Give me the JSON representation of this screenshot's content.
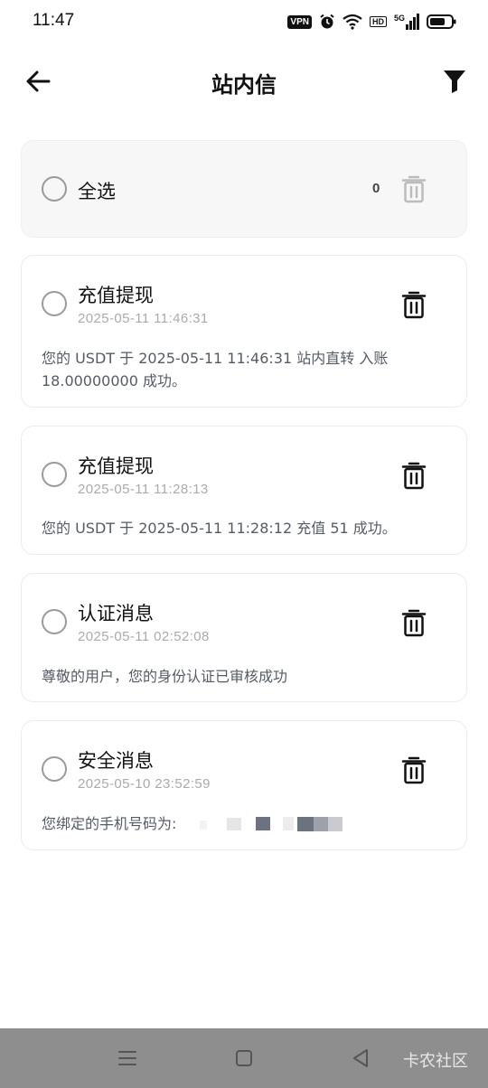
{
  "status_bar": {
    "time": "11:47",
    "vpn_label": "VPN",
    "hd_label": "HD",
    "network_label": "5G"
  },
  "header": {
    "title": "站内信",
    "back_icon": "arrow-left-icon",
    "filter_icon": "filter-icon"
  },
  "select_all": {
    "label": "全选",
    "count": "0"
  },
  "messages": [
    {
      "title": "充值提现",
      "time": "2025-05-11 11:46:31",
      "body": "您的 USDT 于 2025-05-11 11:46:31 站内直转 入账 18.00000000 成功。"
    },
    {
      "title": "充值提现",
      "time": "2025-05-11 11:28:13",
      "body": "您的 USDT 于 2025-05-11 11:28:12 充值 51 成功。"
    },
    {
      "title": "认证消息",
      "time": "2025-05-11 02:52:08",
      "body": "尊敬的用户，您的身份认证已审核成功"
    },
    {
      "title": "安全消息",
      "time": "2025-05-10 23:52:59",
      "body": "您绑定的手机号码为:"
    }
  ],
  "nav_bar": {
    "watermark": "卡农社区"
  },
  "colors": {
    "accent": "#111111",
    "card_border": "#ececec",
    "select_bg": "#f7f7f7",
    "time_text": "#aaaaaa",
    "body_text": "#555b66",
    "nav_bg": "#8e8e8e"
  }
}
